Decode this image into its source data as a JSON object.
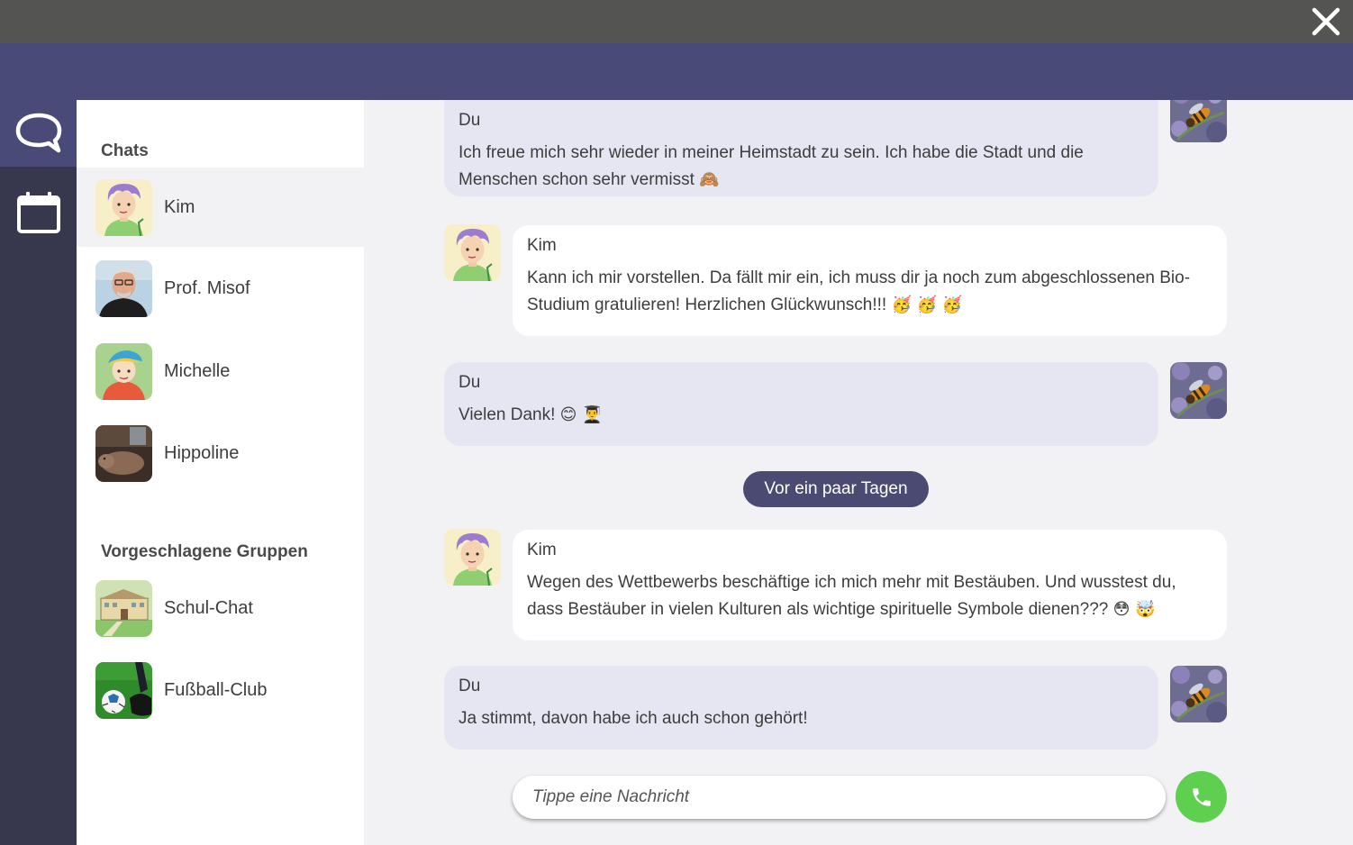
{
  "sidebar": {
    "chats_title": "Chats",
    "chats": [
      {
        "name": "Kim",
        "avatar": "kim-avatar"
      },
      {
        "name": "Prof. Misof",
        "avatar": "misof-avatar"
      },
      {
        "name": "Michelle",
        "avatar": "michelle-avatar"
      },
      {
        "name": "Hippoline",
        "avatar": "hippoline-avatar"
      }
    ],
    "groups_title": "Vorgeschlagene Gruppen",
    "groups": [
      {
        "name": "Schul-Chat",
        "avatar": "school-avatar"
      },
      {
        "name": "Fußball-Club",
        "avatar": "football-avatar"
      }
    ]
  },
  "rail": {
    "items": [
      "chat-bubble-icon",
      "calendar-icon"
    ]
  },
  "messages": [
    {
      "sender": "Du",
      "text": "Ich freue mich sehr wieder in meiner Heimstadt zu sein. Ich habe die Stadt und die Menschen schon sehr vermisst",
      "emoji": "🙈"
    },
    {
      "sender": "Kim",
      "text": "Kann ich mir vorstellen. Da fällt mir ein, ich muss dir ja noch zum abgeschlossenen Bio-Studium gratulieren! Herzlichen Glückwunsch!!!",
      "emoji": "🥳 🥳 🥳"
    },
    {
      "sender": "Du",
      "text": "Vielen Dank!",
      "emoji": "😊 👨‍🎓"
    },
    {
      "sender": "Kim",
      "text": "Wegen des Wettbewerbs beschäftige ich mich mehr mit Bestäuben. Und wusstest du, dass Bestäuber in vielen Kulturen als wichtige spirituelle Symbole dienen???",
      "emoji": "😳 🤯"
    },
    {
      "sender": "Du",
      "text": "Ja stimmt, davon habe ich auch schon gehört!",
      "emoji": ""
    }
  ],
  "date_separator": "Vor ein paar Tagen",
  "composer": {
    "placeholder": "Tippe eine Nachricht",
    "call_icon": "phone-icon"
  },
  "colors": {
    "topbar": "#545452",
    "header": "#4a4a78",
    "rail": "#37374e",
    "my_bubble": "#e6e6f2",
    "call_button": "#5ecf4f"
  }
}
